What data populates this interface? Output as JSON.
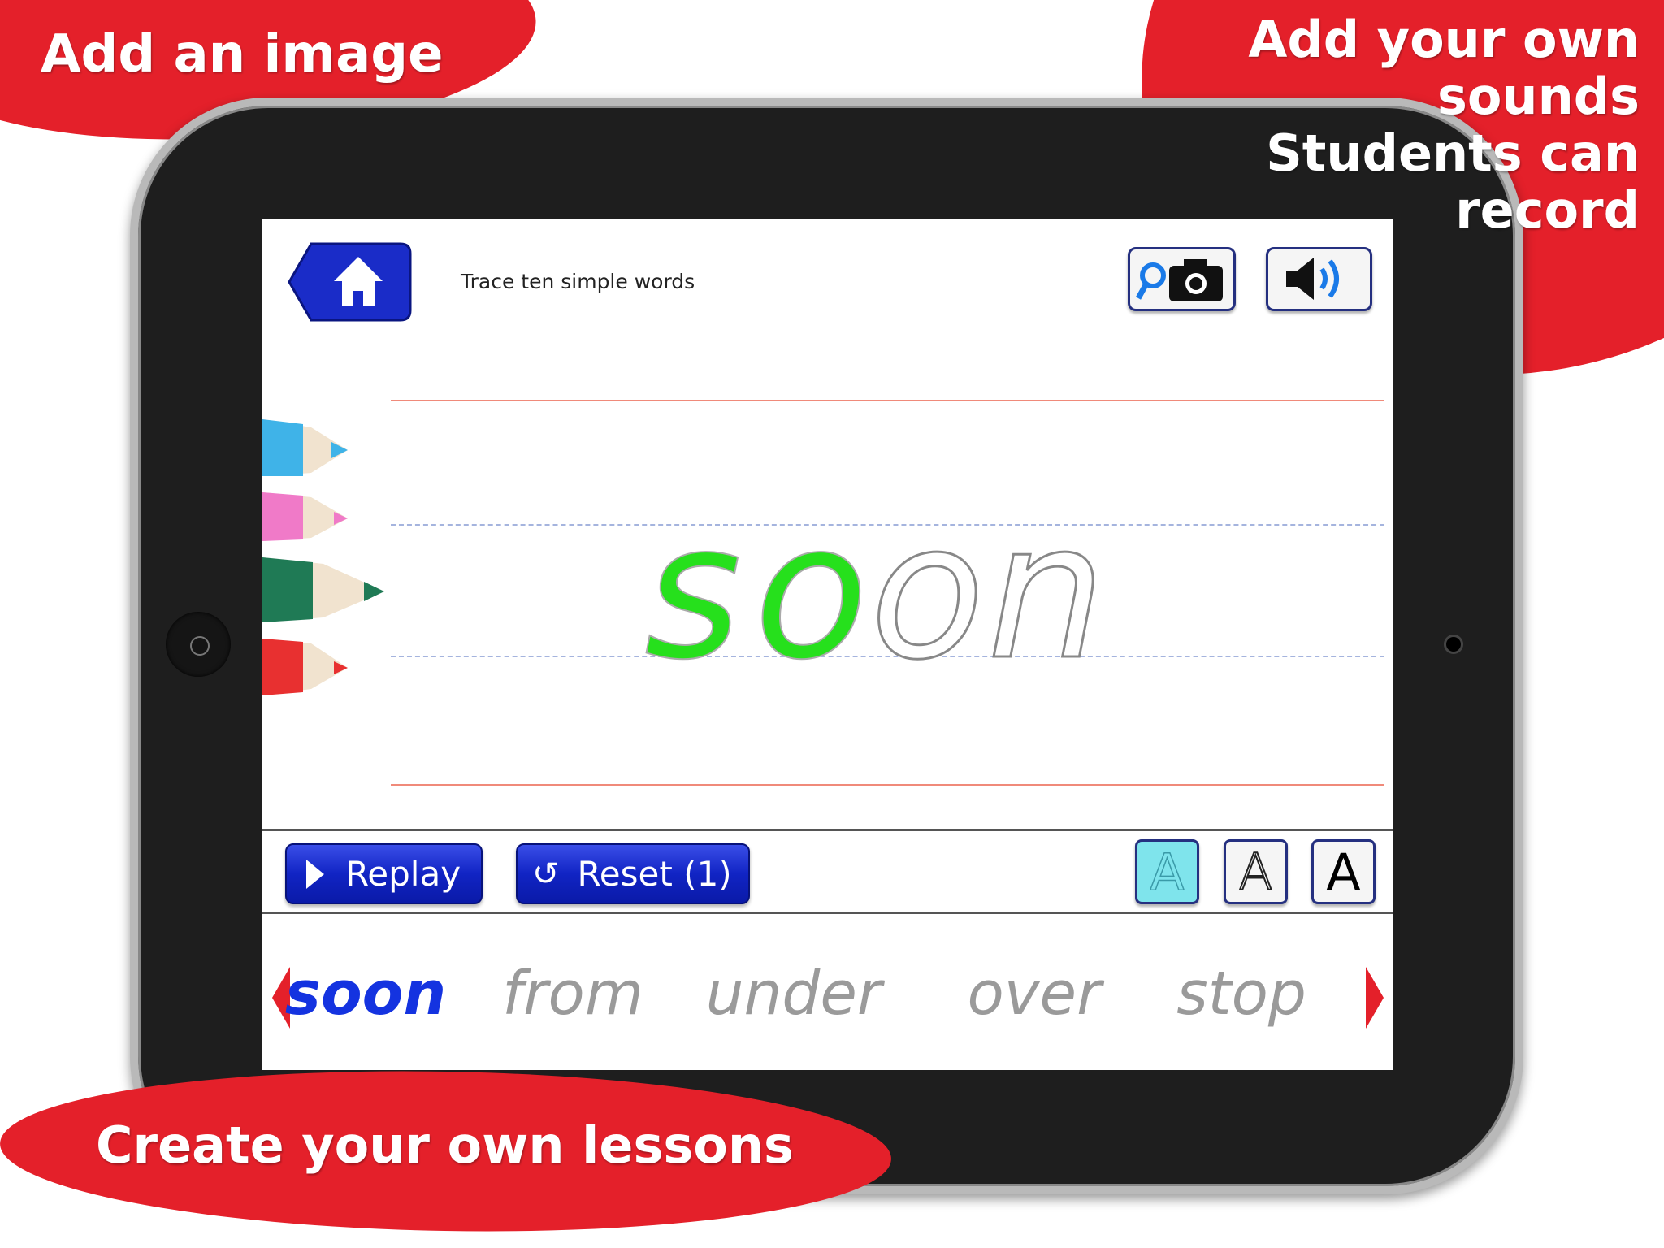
{
  "captions": {
    "top_left": "Add an image",
    "top_right": [
      "Add your own",
      "sounds",
      "Students can",
      "record"
    ],
    "bottom": "Create your own lessons"
  },
  "app": {
    "title": "Trace ten simple words",
    "current_word": "soon",
    "traced_letters": 2,
    "replay_label": "Replay",
    "reset_label": "Reset (1)",
    "font_styles": [
      "A",
      "A",
      "A"
    ],
    "words": [
      "soon",
      "from",
      "under",
      "over",
      "stop"
    ],
    "selected_word_index": 0
  },
  "colors": {
    "brand_red": "#e4202a",
    "button_blue": "#1124c4",
    "trace_green": "#22e01a",
    "selected_word": "#1433e0",
    "font_style_active": "#7fe4ec"
  }
}
